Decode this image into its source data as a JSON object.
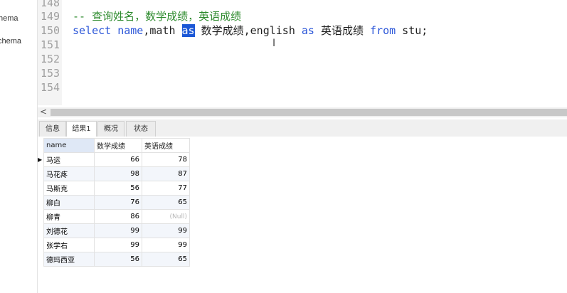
{
  "navigator": {
    "items": [
      "hema",
      "chema"
    ]
  },
  "editor": {
    "line_numbers": [
      "148",
      "149",
      "150",
      "151",
      "152",
      "153",
      "154"
    ],
    "line149_comment": "-- 查询姓名，数学成绩，英语成绩",
    "line150": {
      "t1": "select",
      "t2": " name",
      "t3": ",math ",
      "t4": "as",
      "t5": " 数学成绩,english ",
      "t6": "as",
      "t7": " 英语成绩 ",
      "t8": "from",
      "t9": " stu;"
    }
  },
  "scrollbar": {
    "left_arrow": "<"
  },
  "result_tabs": [
    "信息",
    "结果1",
    "概况",
    "状态"
  ],
  "grid": {
    "columns": [
      "name",
      "数学成绩",
      "英语成绩"
    ],
    "rows": [
      [
        "马运",
        "66",
        "78"
      ],
      [
        "马花疼",
        "98",
        "87"
      ],
      [
        "马斯克",
        "56",
        "77"
      ],
      [
        "柳白",
        "76",
        "65"
      ],
      [
        "柳青",
        "86",
        "(Null)"
      ],
      [
        "刘德花",
        "99",
        "99"
      ],
      [
        "张学右",
        "99",
        "99"
      ],
      [
        "德玛西亚",
        "56",
        "65"
      ]
    ]
  },
  "colors": {
    "keyword": "#2a55d8",
    "comment": "#2e8b2e",
    "selection": "#1b57d6",
    "header_highlight": "#dfe8f6"
  }
}
